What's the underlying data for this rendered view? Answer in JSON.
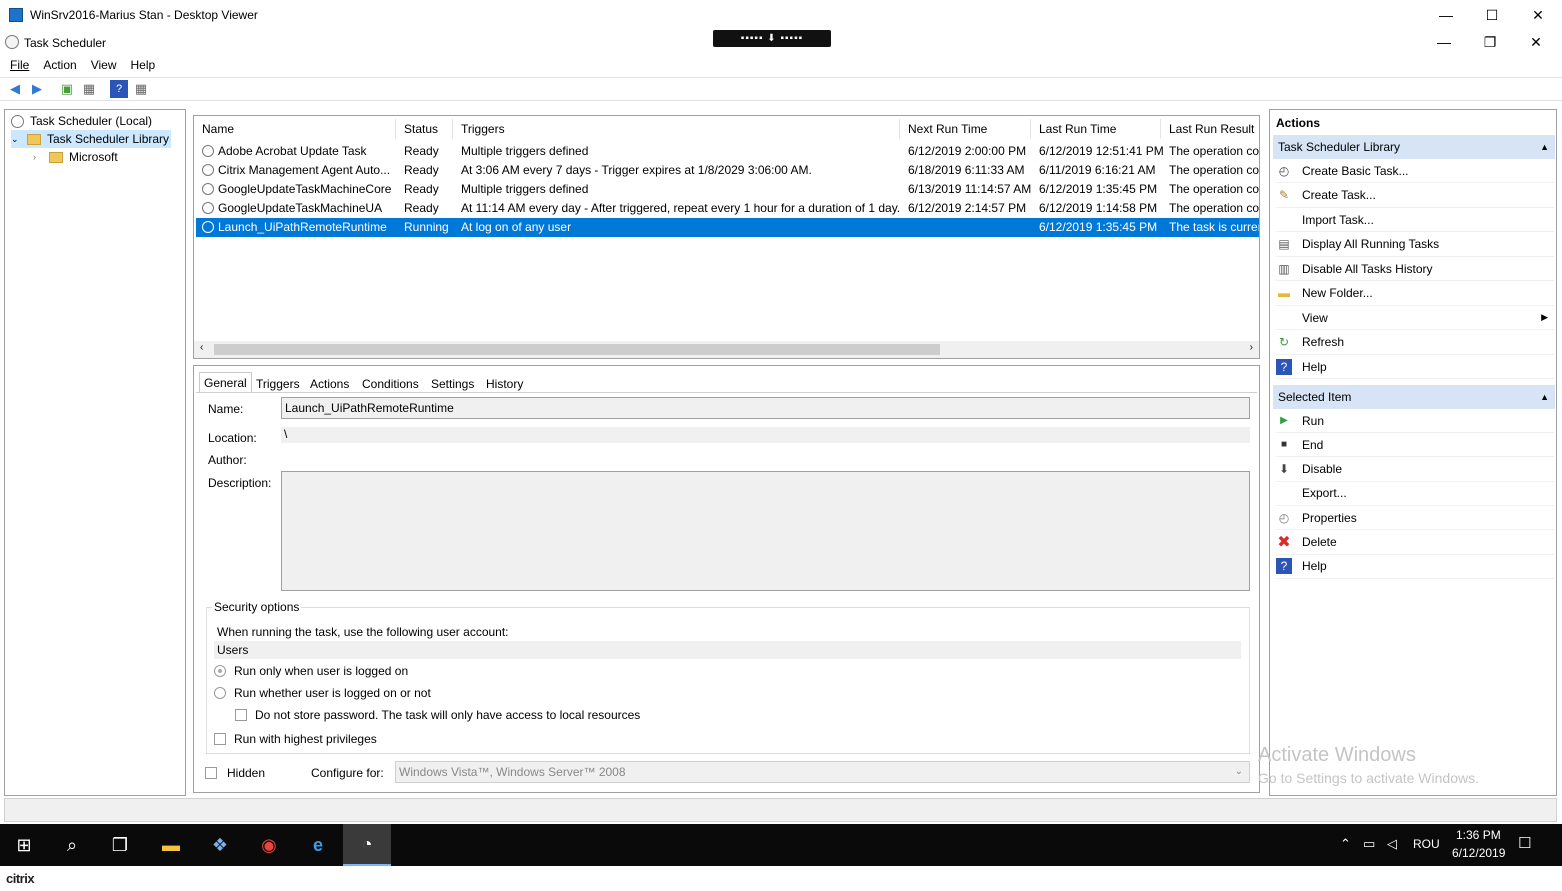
{
  "viewer": {
    "title": "WinSrv2016-Marius Stan - Desktop Viewer",
    "citrix_bar": "▪▪▪▪▪ ⬇ ▪▪▪▪▪"
  },
  "app": {
    "title": "Task Scheduler"
  },
  "menu": [
    "File",
    "Action",
    "View",
    "Help"
  ],
  "tree": {
    "root": "Task Scheduler (Local)",
    "library": "Task Scheduler Library",
    "child": "Microsoft"
  },
  "columns": [
    "Name",
    "Status",
    "Triggers",
    "Next Run Time",
    "Last Run Time",
    "Last Run Result"
  ],
  "tasks": [
    {
      "name": "Adobe Acrobat Update Task",
      "status": "Ready",
      "triggers": "Multiple triggers defined",
      "next": "6/12/2019 2:00:00 PM",
      "last": "6/12/2019 12:51:41 PM",
      "result": "The operation co"
    },
    {
      "name": "Citrix Management Agent Auto...",
      "status": "Ready",
      "triggers": "At 3:06 AM every 7 days - Trigger expires at 1/8/2029 3:06:00 AM.",
      "next": "6/18/2019 6:11:33 AM",
      "last": "6/11/2019 6:16:21 AM",
      "result": "The operation co"
    },
    {
      "name": "GoogleUpdateTaskMachineCore",
      "status": "Ready",
      "triggers": "Multiple triggers defined",
      "next": "6/13/2019 11:14:57 AM",
      "last": "6/12/2019 1:35:45 PM",
      "result": "The operation co"
    },
    {
      "name": "GoogleUpdateTaskMachineUA",
      "status": "Ready",
      "triggers": "At 11:14 AM every day - After triggered, repeat every 1 hour for a duration of 1 day.",
      "next": "6/12/2019 2:14:57 PM",
      "last": "6/12/2019 1:14:58 PM",
      "result": "The operation co"
    },
    {
      "name": "Launch_UiPathRemoteRuntime",
      "status": "Running",
      "triggers": "At log on of any user",
      "next": "",
      "last": "6/12/2019 1:35:45 PM",
      "result": "The task is curren"
    }
  ],
  "tabs": [
    "General",
    "Triggers",
    "Actions",
    "Conditions",
    "Settings",
    "History"
  ],
  "general": {
    "name_label": "Name:",
    "name_value": "Launch_UiPathRemoteRuntime",
    "location_label": "Location:",
    "location_value": "\\",
    "author_label": "Author:",
    "description_label": "Description:",
    "security_title": "Security options",
    "account_text": "When running the task, use the following user account:",
    "account_value": "Users",
    "opt_logged_on": "Run only when user is logged on",
    "opt_whether": "Run whether user is logged on or not",
    "opt_no_store": "Do not store password.  The task will only have access to local resources",
    "opt_highest": "Run with highest privileges",
    "hidden": "Hidden",
    "configure_label": "Configure for:",
    "configure_value": "Windows Vista™, Windows Server™ 2008"
  },
  "actions": {
    "header": "Actions",
    "library_section": "Task Scheduler Library",
    "library_items": [
      "Create Basic Task...",
      "Create Task...",
      "Import Task...",
      "Display All Running Tasks",
      "Disable All Tasks History",
      "New Folder...",
      "View",
      "Refresh",
      "Help"
    ],
    "selected_section": "Selected Item",
    "selected_items": [
      "Run",
      "End",
      "Disable",
      "Export...",
      "Properties",
      "Delete",
      "Help"
    ]
  },
  "watermark": {
    "line1": "Activate Windows",
    "line2": "Go to Settings to activate Windows."
  },
  "taskbar": {
    "time": "1:36 PM",
    "date": "6/12/2019",
    "lang": "ROU"
  },
  "citrix_logo": "citrix"
}
